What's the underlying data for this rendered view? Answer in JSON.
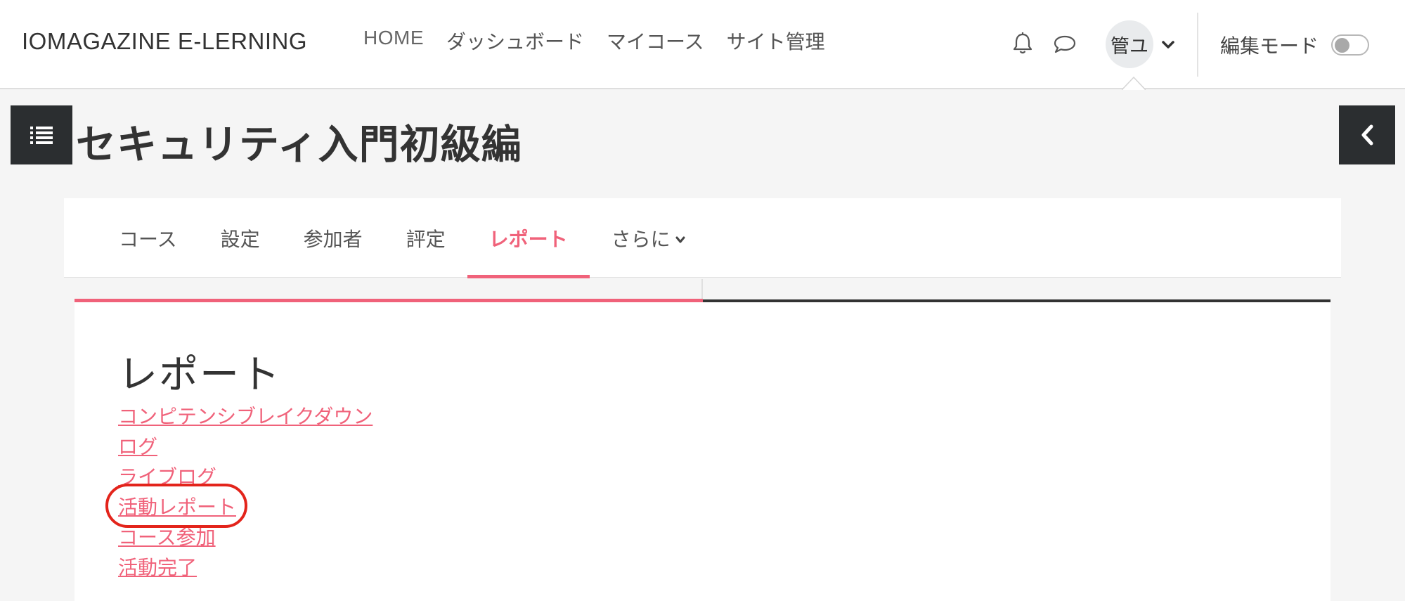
{
  "navbar": {
    "brand": "IOMAGAZINE E-LERNING",
    "links": [
      "HOME",
      "ダッシュボード",
      "マイコース",
      "サイト管理"
    ],
    "icons": {
      "notifications": "bell-icon",
      "messages": "chat-bubble-icon"
    },
    "user_initials": "管ユ",
    "edit_mode_label": "編集モード",
    "edit_mode_on": false
  },
  "header": {
    "course_title": "セキュリティ入門初級編",
    "left_drawer_icon": "list-icon",
    "right_drawer_icon": "chevron-left-icon"
  },
  "secondary_nav": {
    "tabs": [
      "コース",
      "設定",
      "参加者",
      "評定",
      "レポート",
      "さらに"
    ],
    "active_tab": "レポート"
  },
  "main": {
    "heading": "レポート",
    "report_links": [
      "コンピテンシブレイクダウン",
      "ログ",
      "ライブログ",
      "活動レポート",
      "コース参加",
      "活動完了"
    ],
    "highlighted_link": "活動レポート"
  },
  "colors": {
    "accent": "#f0627a",
    "dark": "#2b2e30",
    "highlight_ring": "#e3241b",
    "background": "#f5f5f5"
  }
}
